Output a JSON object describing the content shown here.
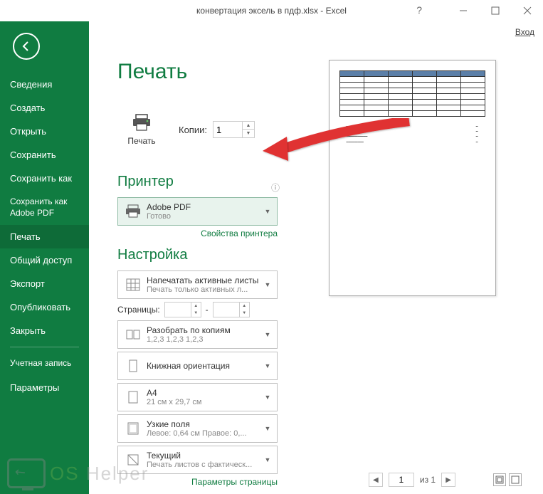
{
  "titlebar": {
    "title": "конвертация эксель в пдф.xlsx - Excel",
    "login": "Вход"
  },
  "sidebar": {
    "items": [
      {
        "label": "Сведения"
      },
      {
        "label": "Создать"
      },
      {
        "label": "Открыть"
      },
      {
        "label": "Сохранить"
      },
      {
        "label": "Сохранить как"
      },
      {
        "label": "Сохранить как Adobe PDF"
      },
      {
        "label": "Печать"
      },
      {
        "label": "Общий доступ"
      },
      {
        "label": "Экспорт"
      },
      {
        "label": "Опубликовать"
      },
      {
        "label": "Закрыть"
      },
      {
        "label": "Учетная запись"
      },
      {
        "label": "Параметры"
      }
    ]
  },
  "print": {
    "page_title": "Печать",
    "button_label": "Печать",
    "copies_label": "Копии:",
    "copies_value": "1"
  },
  "printer": {
    "section": "Принтер",
    "name": "Adobe PDF",
    "status": "Готово",
    "properties_link": "Свойства принтера"
  },
  "settings": {
    "section": "Настройка",
    "print_what": {
      "title": "Напечатать активные листы",
      "sub": "Печать только активных л..."
    },
    "pages_label": "Страницы:",
    "pages_sep": "-",
    "collate": {
      "title": "Разобрать по копиям",
      "sub": "1,2,3   1,2,3   1,2,3"
    },
    "orientation": {
      "title": "Книжная ориентация"
    },
    "paper": {
      "title": "A4",
      "sub": "21 см x 29,7 см"
    },
    "margins": {
      "title": "Узкие поля",
      "sub": "Левое: 0,64 см  Правое: 0,..."
    },
    "scaling": {
      "title": "Текущий",
      "sub": "Печать листов с фактическ..."
    },
    "page_params_link": "Параметры страницы"
  },
  "nav": {
    "current": "1",
    "of_label": "из 1"
  },
  "watermark": {
    "text_pre": "OS",
    "text_post": "Helper"
  }
}
